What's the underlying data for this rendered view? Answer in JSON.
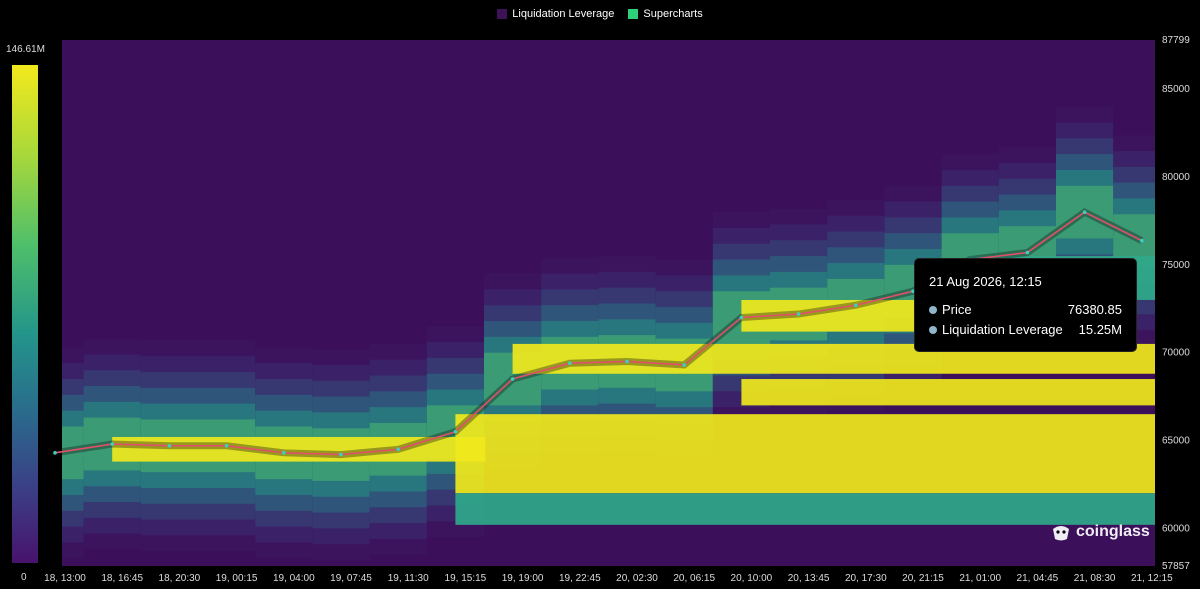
{
  "legend": {
    "items": [
      {
        "label": "Liquidation Leverage",
        "color": "#3d1257"
      },
      {
        "label": "Supercharts",
        "color": "#2fd07a"
      }
    ]
  },
  "color_scale": {
    "max_label": "146.61M",
    "min_label": "0"
  },
  "chart_data": {
    "type": "heatmap",
    "title": "",
    "xlabel": "",
    "ylabel": "",
    "x_ticks": [
      "18, 13:00",
      "18, 16:45",
      "18, 20:30",
      "19, 00:15",
      "19, 04:00",
      "19, 07:45",
      "19, 11:30",
      "19, 15:15",
      "19, 19:00",
      "19, 22:45",
      "20, 02:30",
      "20, 06:15",
      "20, 10:00",
      "20, 13:45",
      "20, 17:30",
      "20, 21:15",
      "21, 01:00",
      "21, 04:45",
      "21, 08:30",
      "21, 12:15"
    ],
    "y_ticks": [
      60000,
      65000,
      70000,
      75000,
      80000,
      85000
    ],
    "y_range": [
      57857,
      87799
    ],
    "y_range_labels": [
      "57857",
      "87799"
    ],
    "value_range": [
      0,
      146.61
    ],
    "value_unit": "M",
    "price_series": [
      {
        "t": "18, 13:00",
        "price": 64300
      },
      {
        "t": "18, 16:45",
        "price": 64800
      },
      {
        "t": "18, 20:30",
        "price": 64700
      },
      {
        "t": "19, 00:15",
        "price": 64700
      },
      {
        "t": "19, 04:00",
        "price": 64300
      },
      {
        "t": "19, 07:45",
        "price": 64200
      },
      {
        "t": "19, 11:30",
        "price": 64500
      },
      {
        "t": "19, 15:15",
        "price": 65500
      },
      {
        "t": "19, 19:00",
        "price": 68500
      },
      {
        "t": "19, 22:45",
        "price": 69400
      },
      {
        "t": "20, 02:30",
        "price": 69500
      },
      {
        "t": "20, 06:15",
        "price": 69300
      },
      {
        "t": "20, 10:00",
        "price": 72000
      },
      {
        "t": "20, 13:45",
        "price": 72200
      },
      {
        "t": "20, 17:30",
        "price": 72700
      },
      {
        "t": "20, 21:15",
        "price": 73500
      },
      {
        "t": "21, 01:00",
        "price": 75300
      },
      {
        "t": "21, 04:45",
        "price": 75700
      },
      {
        "t": "21, 08:30",
        "price": 78000
      },
      {
        "t": "21, 12:15",
        "price": 76380
      }
    ],
    "liquidation_bands": [
      {
        "from": "18, 16:45",
        "to": "19, 15:15",
        "price_low": 63800,
        "price_high": 65200,
        "level": "high"
      },
      {
        "from": "19, 15:15",
        "to": "21, 12:15",
        "price_low": 62000,
        "price_high": 66500,
        "level": "high"
      },
      {
        "from": "19, 19:00",
        "to": "21, 12:15",
        "price_low": 68800,
        "price_high": 70500,
        "level": "high"
      },
      {
        "from": "20, 10:00",
        "to": "21, 01:00",
        "price_low": 71200,
        "price_high": 73000,
        "level": "high"
      },
      {
        "from": "20, 10:00",
        "to": "21, 12:15",
        "price_low": 67000,
        "price_high": 68500,
        "level": "high"
      },
      {
        "from": "19, 15:15",
        "to": "21, 12:15",
        "price_low": 60200,
        "price_high": 62000,
        "level": "medium"
      },
      {
        "from": "21, 01:00",
        "to": "21, 12:15",
        "price_low": 73000,
        "price_high": 75500,
        "level": "medium"
      }
    ]
  },
  "tooltip": {
    "title": "21 Aug 2026, 12:15",
    "rows": [
      {
        "label": "Price",
        "value": "76380.85"
      },
      {
        "label": "Liquidation Leverage",
        "value": "15.25M"
      }
    ]
  },
  "branding": {
    "name": "coinglass"
  }
}
